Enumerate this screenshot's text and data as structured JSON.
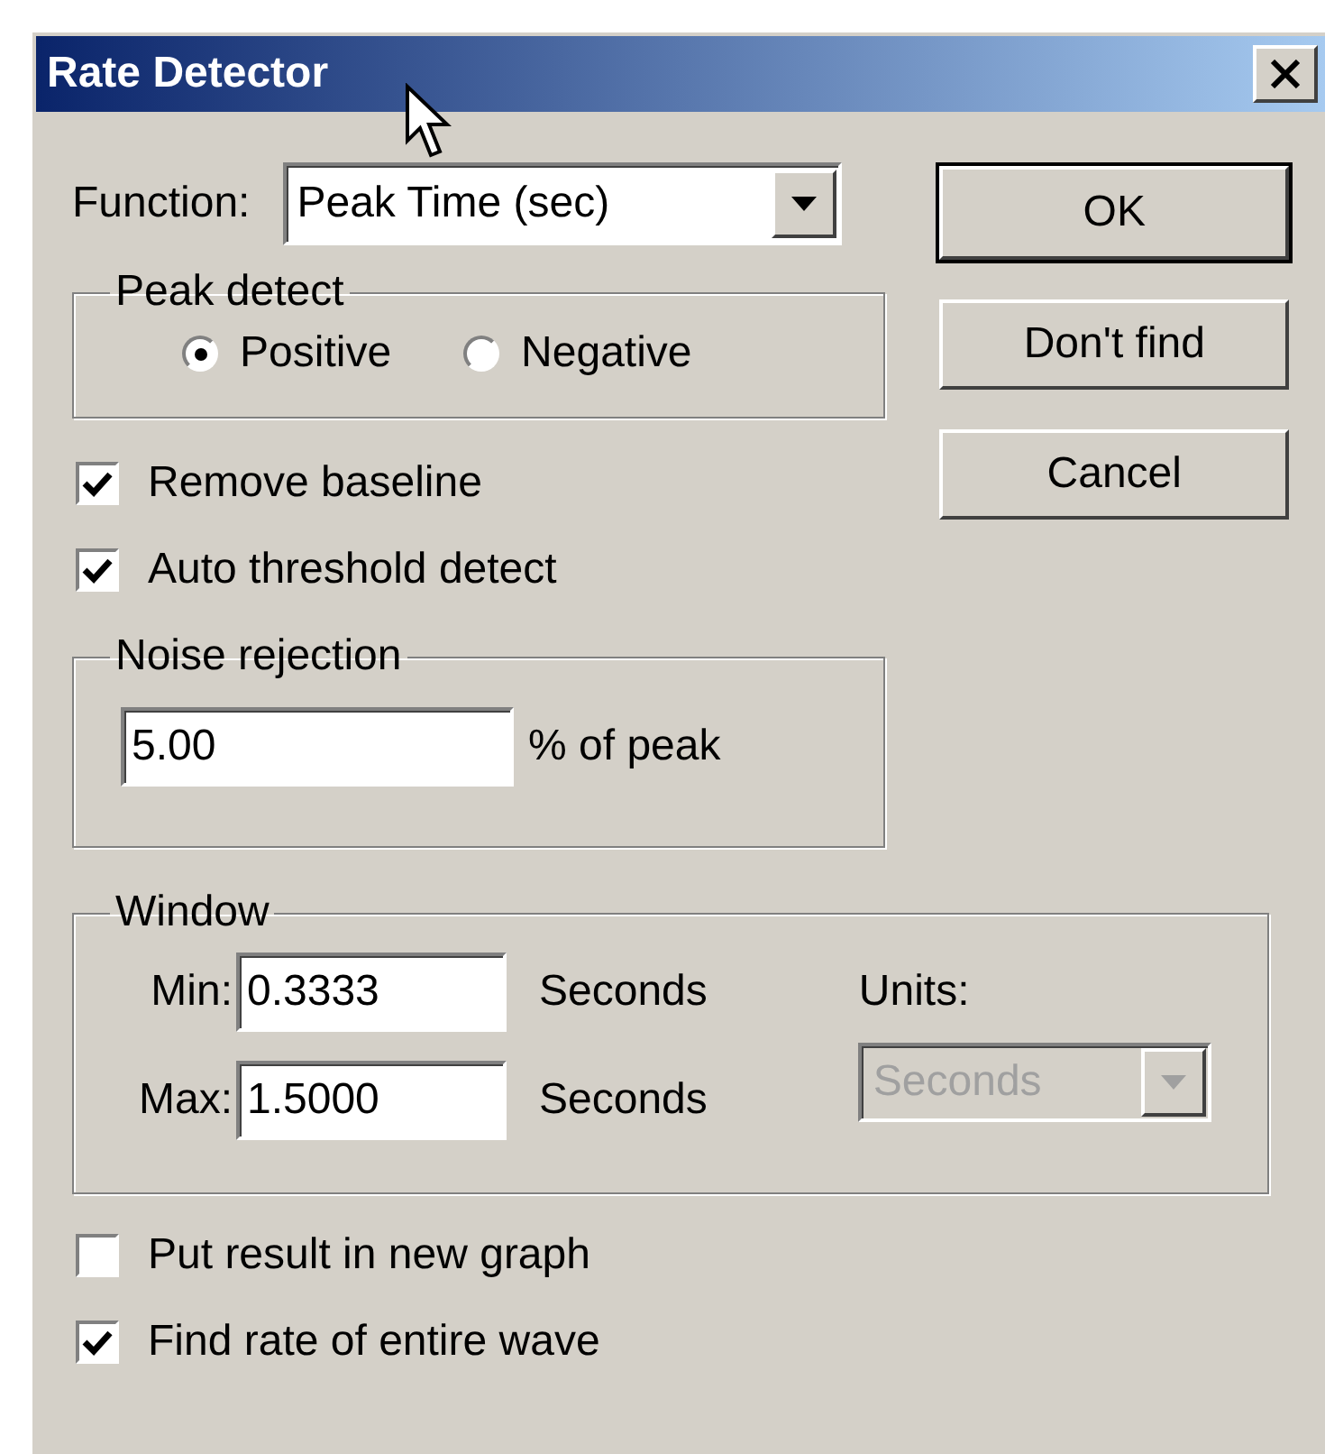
{
  "window": {
    "title": "Rate Detector"
  },
  "function": {
    "label": "Function:",
    "value": "Peak Time (sec)"
  },
  "peak_detect": {
    "label": "Peak detect",
    "options": [
      {
        "label": "Positive",
        "selected": true
      },
      {
        "label": "Negative",
        "selected": false
      }
    ]
  },
  "options_top": [
    {
      "label": "Remove baseline",
      "checked": true
    },
    {
      "label": "Auto threshold detect",
      "checked": true
    }
  ],
  "noise_rejection": {
    "label": "Noise rejection",
    "value": "5.00",
    "suffix": "% of peak"
  },
  "window_group": {
    "label": "Window",
    "rows": [
      {
        "label": "Min:",
        "value": "0.3333",
        "unit": "Seconds"
      },
      {
        "label": "Max:",
        "value": "1.5000",
        "unit": "Seconds"
      }
    ],
    "units_label": "Units:",
    "units": {
      "value": "Seconds",
      "disabled": true
    }
  },
  "options_bottom": [
    {
      "label": "Put result in new graph",
      "checked": false
    },
    {
      "label": "Find rate of entire wave",
      "checked": true
    }
  ],
  "buttons": [
    {
      "label": "OK",
      "default": true
    },
    {
      "label": "Don't find",
      "default": false
    },
    {
      "label": "Cancel",
      "default": false
    }
  ]
}
